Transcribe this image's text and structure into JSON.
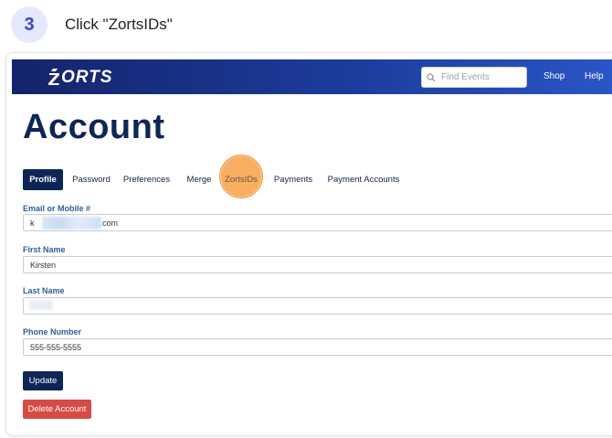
{
  "step": {
    "number": "3",
    "instruction": "Click \"ZortsIDs\""
  },
  "header": {
    "logo_text": "ORTS",
    "logo_lettering": "ZORTS",
    "search_placeholder": "Find Events",
    "nav": [
      "Shop",
      "Help"
    ]
  },
  "page": {
    "title": "Account"
  },
  "tabs": [
    {
      "label": "Profile",
      "active": true
    },
    {
      "label": "Password"
    },
    {
      "label": "Preferences"
    },
    {
      "label": "Merge"
    },
    {
      "label": "ZortsIDs",
      "highlighted": true
    },
    {
      "label": "Payments"
    },
    {
      "label": "Payment Accounts"
    }
  ],
  "form": {
    "email": {
      "label": "Email or Mobile #",
      "value_prefix": "k",
      "value_suffix": ".com"
    },
    "first_name": {
      "label": "First Name",
      "value": "Kirsten"
    },
    "last_name": {
      "label": "Last Name",
      "value": ""
    },
    "phone": {
      "label": "Phone Number",
      "value": "555-555-5555"
    }
  },
  "buttons": {
    "update": "Update",
    "delete": "Delete Account"
  },
  "colors": {
    "navy": "#0e2557",
    "header_gradient_start": "#14246a",
    "header_gradient_end": "#2a56c7",
    "label_blue": "#2f5f98",
    "highlight_orange": "#f79e3e",
    "delete_red": "#d64b45",
    "badge_bg": "#e6e9fb",
    "badge_text": "#3a46c5"
  }
}
